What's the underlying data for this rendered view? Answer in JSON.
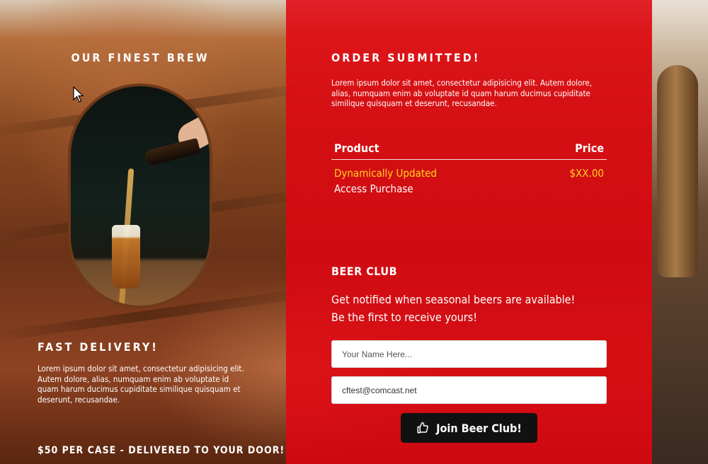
{
  "left": {
    "title": "OUR FINEST BREW",
    "fast_delivery": {
      "title": "FAST DELIVERY!",
      "body": "Lorem ipsum dolor sit amet, consectetur adipisicing elit. Autem dolore, alias, numquam enim ab voluptate id quam harum ducimus cupiditate similique quisquam et deserunt, recusandae."
    },
    "price_line": "$50 PER CASE - DELIVERED TO YOUR DOOR!"
  },
  "order": {
    "title": "ORDER SUBMITTED!",
    "body": "Lorem ipsum dolor sit amet, consectetur adipisicing elit. Autem dolore, alias, numquam enim ab voluptate id quam harum ducimus cupiditate similique quisquam et deserunt, recusandae.",
    "table": {
      "col_product": "Product",
      "col_price": "Price",
      "item_name": "Dynamically Updated",
      "item_price": "$XX.00",
      "item_subtitle": "Access Purchase"
    }
  },
  "club": {
    "title": "BEER CLUB",
    "line1": "Get notified when seasonal beers are available!",
    "line2": "Be the first to receive yours!",
    "name_placeholder": "Your Name Here...",
    "email_value": "cftest@comcast.net",
    "button_label": "Join Beer Club!",
    "button_icon": "thumbs-up-icon"
  },
  "colors": {
    "overlay": "#e10612",
    "price_accent": "#ffd21a",
    "button": "#111111"
  }
}
